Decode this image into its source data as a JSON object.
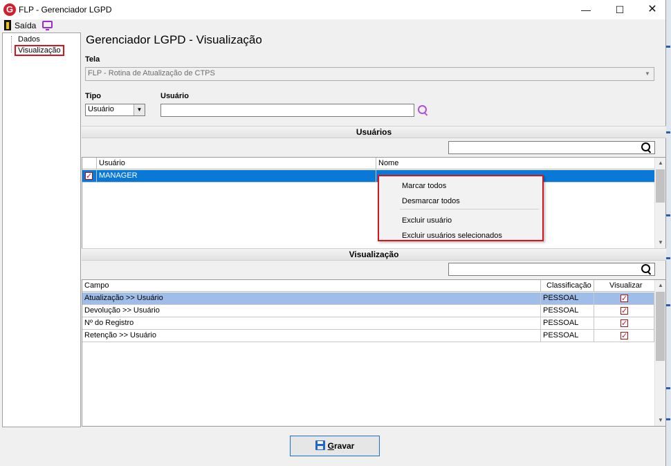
{
  "window": {
    "title": "FLP - Gerenciador LGPD",
    "icon_letter": "G"
  },
  "menubar": {
    "exit_label": "Saída"
  },
  "nav": {
    "items": [
      {
        "label": "Dados"
      },
      {
        "label": "Visualização"
      }
    ]
  },
  "page": {
    "title": "Gerenciador LGPD - Visualização"
  },
  "form": {
    "tela_label": "Tela",
    "tela_value": "FLP - Rotina de Atualização de CTPS",
    "tipo_label": "Tipo",
    "tipo_value": "Usuário",
    "usuario_label": "Usuário",
    "usuario_value": ""
  },
  "users_section": {
    "header": "Usuários",
    "filter_value": "",
    "columns": [
      "Usuário",
      "Nome"
    ],
    "rows": [
      {
        "checked": true,
        "usuario": "MANAGER",
        "nome": ""
      }
    ]
  },
  "context_menu": {
    "items": [
      "Marcar todos",
      "Desmarcar todos",
      "Excluir usuário",
      "Excluir usuários selecionados"
    ]
  },
  "view_section": {
    "header": "Visualização",
    "filter_value": "",
    "columns": [
      "Campo",
      "Classificação",
      "Visualizar"
    ],
    "rows": [
      {
        "campo": "Atualização >> Usuário",
        "classificacao": "PESSOAL",
        "visualizar": true
      },
      {
        "campo": "Devolução >> Usuário",
        "classificacao": "PESSOAL",
        "visualizar": true
      },
      {
        "campo": "Nº do Registro",
        "classificacao": "PESSOAL",
        "visualizar": true
      },
      {
        "campo": "Retenção >> Usuário",
        "classificacao": "PESSOAL",
        "visualizar": true
      }
    ]
  },
  "footer": {
    "save_label": "Gravar"
  },
  "colors": {
    "accent_red": "#d8131b",
    "selection_blue": "#0a78d7",
    "selection_light": "#9fbde8",
    "search_purple": "#b04fd8"
  },
  "icons": [
    "app-logo-icon",
    "exit-door-icon",
    "monitor-icon",
    "search-icon",
    "save-disk-icon"
  ]
}
